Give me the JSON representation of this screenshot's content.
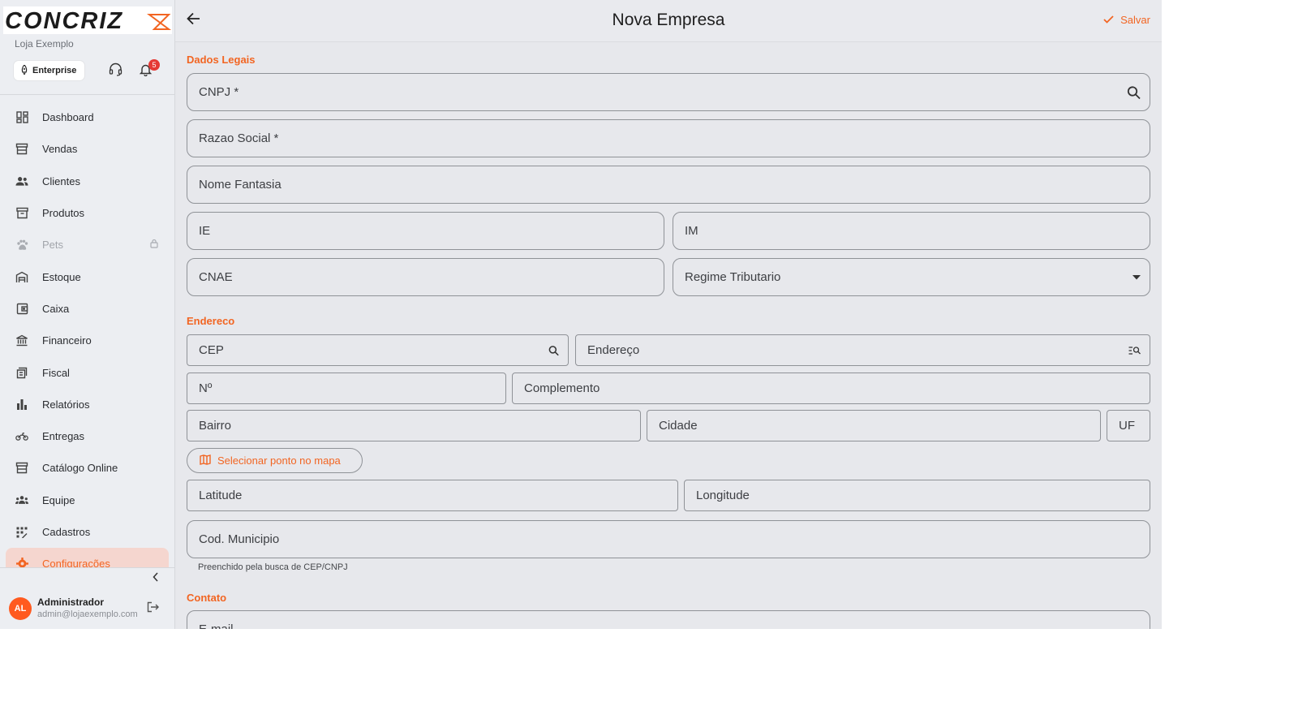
{
  "brand": {
    "logo_text": "CONCRIZ",
    "store_name": "Loja Exemplo",
    "plan": "Enterprise",
    "notifications": "5",
    "accent": "#f26522"
  },
  "sidebar": {
    "items": [
      {
        "label": "Dashboard",
        "icon": "dashboard-icon"
      },
      {
        "label": "Vendas",
        "icon": "storefront-icon"
      },
      {
        "label": "Clientes",
        "icon": "people-icon"
      },
      {
        "label": "Produtos",
        "icon": "archive-icon"
      },
      {
        "label": "Pets",
        "icon": "paw-icon"
      },
      {
        "label": "Estoque",
        "icon": "warehouse-icon"
      },
      {
        "label": "Caixa",
        "icon": "wallet-icon"
      },
      {
        "label": "Financeiro",
        "icon": "bank-icon"
      },
      {
        "label": "Fiscal",
        "icon": "receipt-icon"
      },
      {
        "label": "Relatórios",
        "icon": "bar-chart-icon"
      },
      {
        "label": "Entregas",
        "icon": "motorcycle-icon"
      },
      {
        "label": "Catálogo Online",
        "icon": "store-icon"
      },
      {
        "label": "Equipe",
        "icon": "group-icon"
      },
      {
        "label": "Cadastros",
        "icon": "apps-icon"
      },
      {
        "label": "Configurações",
        "icon": "gear-icon"
      }
    ]
  },
  "user": {
    "initials": "AL",
    "name": "Administrador",
    "email": "admin@lojaexemplo.com"
  },
  "header": {
    "title": "Nova Empresa",
    "save_label": "Salvar"
  },
  "form": {
    "section_legal": "Dados Legais",
    "cnpj": "CNPJ *",
    "razao_social": "Razao Social *",
    "nome_fantasia": "Nome Fantasia",
    "ie": "IE",
    "im": "IM",
    "cnae": "CNAE",
    "regime": "Regime Tributario",
    "section_address": "Endereco",
    "cep": "CEP",
    "endereco": "Endereço",
    "numero": "Nº",
    "complemento": "Complemento",
    "bairro": "Bairro",
    "cidade": "Cidade",
    "uf": "UF",
    "map_button": "Selecionar ponto no mapa",
    "latitude": "Latitude",
    "longitude": "Longitude",
    "cod_municipio": "Cod. Municipio",
    "cod_municipio_helper": "Preenchido pela busca de CEP/CNPJ",
    "section_contact": "Contato",
    "email": "E-mail"
  }
}
